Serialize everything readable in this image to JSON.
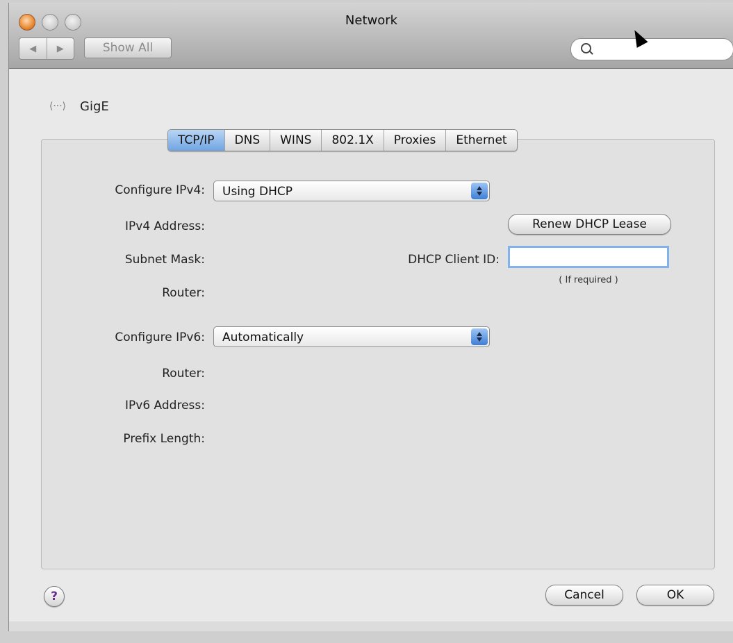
{
  "window": {
    "title": "Network"
  },
  "toolbar": {
    "back_label": "◀",
    "forward_label": "▶",
    "show_all_label": "Show All",
    "search_placeholder": ""
  },
  "interface": {
    "name": "GigE"
  },
  "tabs": [
    {
      "label": "TCP/IP",
      "active": true
    },
    {
      "label": "DNS",
      "active": false
    },
    {
      "label": "WINS",
      "active": false
    },
    {
      "label": "802.1X",
      "active": false
    },
    {
      "label": "Proxies",
      "active": false
    },
    {
      "label": "Ethernet",
      "active": false
    }
  ],
  "ipv4": {
    "configure_label": "Configure IPv4:",
    "configure_value": "Using DHCP",
    "address_label": "IPv4 Address:",
    "subnet_label": "Subnet Mask:",
    "router_label": "Router:",
    "renew_label": "Renew DHCP Lease",
    "client_id_label": "DHCP Client ID:",
    "client_id_value": "",
    "client_id_note": "( If required )"
  },
  "ipv6": {
    "configure_label": "Configure IPv6:",
    "configure_value": "Automatically",
    "router_label": "Router:",
    "address_label": "IPv6 Address:",
    "prefix_label": "Prefix Length:"
  },
  "footer": {
    "help_label": "?",
    "cancel_label": "Cancel",
    "ok_label": "OK"
  },
  "colors": {
    "active_tab": "#7fb0e8",
    "window_bg": "#e9e9e9"
  }
}
